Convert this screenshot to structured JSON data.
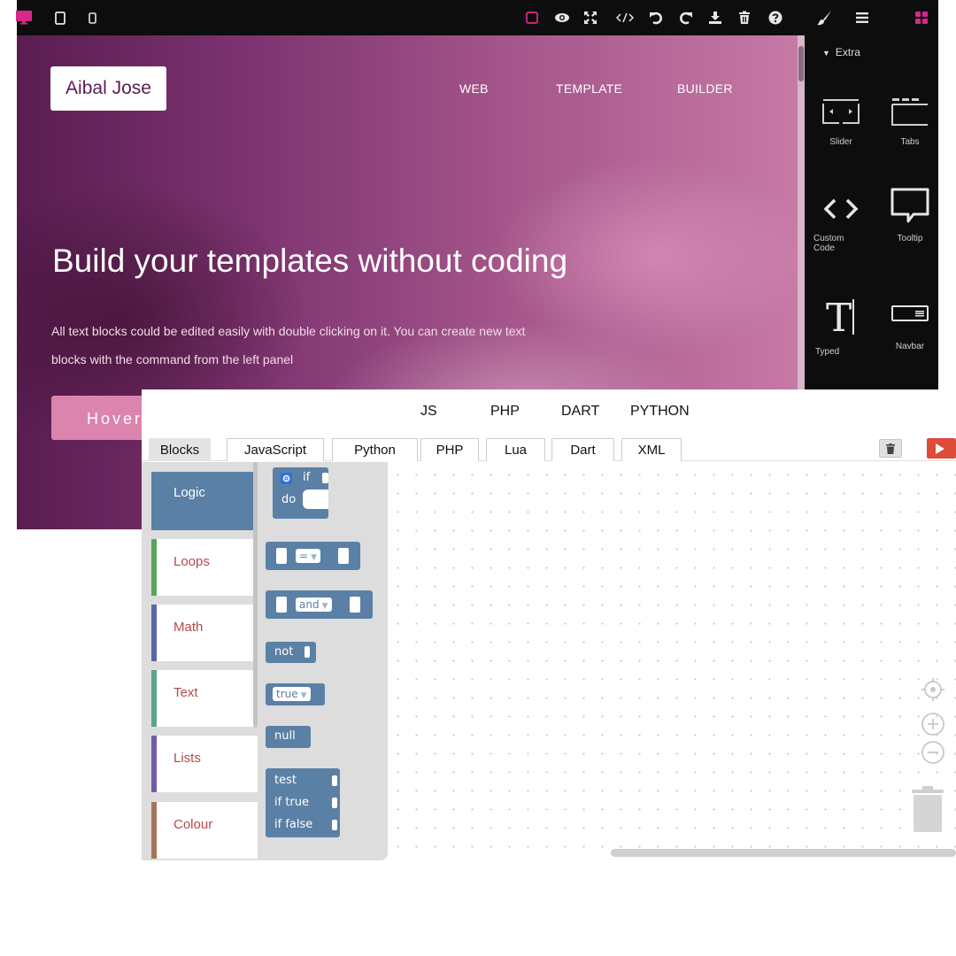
{
  "toolbar": {
    "device_icons": [
      "desktop-icon",
      "tablet-icon",
      "mobile-icon"
    ],
    "action_icons": [
      "sw-visibility-icon",
      "preview-icon",
      "fullscreen-icon",
      "code-icon",
      "undo-icon",
      "redo-icon",
      "download-icon",
      "delete-icon",
      "help-icon"
    ],
    "panel_icons": [
      "style-manager-icon",
      "layer-manager-icon",
      "blocks-icon"
    ],
    "accent_color": "#d6278a"
  },
  "hero": {
    "brand": "Aibal Jose",
    "nav": [
      "WEB",
      "TEMPLATE",
      "BUILDER"
    ],
    "title": "Build your templates without coding",
    "text_line1": "All text blocks could be edited easily with double clicking on it. You can create new text",
    "text_line2": "blocks with the command from the left panel",
    "button": "Hover me"
  },
  "blocks_panel": {
    "category": "Extra",
    "blocks": [
      {
        "label": "Slider",
        "icon": "slider-icon"
      },
      {
        "label": "Tabs",
        "icon": "tabs-icon"
      },
      {
        "label": "Custom Code",
        "icon": "custom-code-icon"
      },
      {
        "label": "Tooltip",
        "icon": "tooltip-icon"
      },
      {
        "label": "Typed",
        "icon": "typed-icon"
      },
      {
        "label": "Navbar",
        "icon": "navbar-icon"
      }
    ]
  },
  "blockly": {
    "languages": [
      "JS",
      "PHP",
      "DART",
      "PYTHON"
    ],
    "tabs": [
      "Blocks",
      "JavaScript",
      "Python",
      "PHP",
      "Lua",
      "Dart",
      "XML"
    ],
    "active_tab": "Blocks",
    "categories": [
      {
        "label": "Logic",
        "color": "#5b80a5",
        "selected": true
      },
      {
        "label": "Loops",
        "color": "#5ba55b"
      },
      {
        "label": "Math",
        "color": "#5b67a5"
      },
      {
        "label": "Text",
        "color": "#5ba58c"
      },
      {
        "label": "Lists",
        "color": "#745ba5"
      },
      {
        "label": "Colour",
        "color": "#a5745b"
      }
    ],
    "flyout": {
      "if_label": "if",
      "do_label": "do",
      "compare_op": "=",
      "logic_op": "and",
      "not_label": "not",
      "boolean_value": "true",
      "null_label": "null",
      "ternary_test": "test",
      "ternary_true": "if true",
      "ternary_false": "if false"
    },
    "block_color": "#5b80a5",
    "run_color": "#dd4b39"
  }
}
